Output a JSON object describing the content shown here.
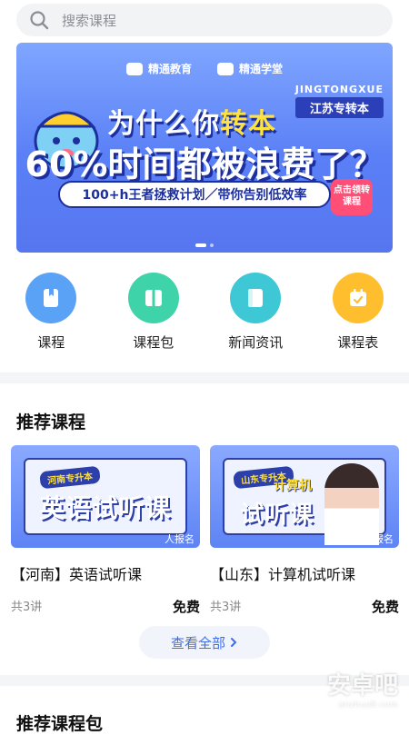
{
  "search": {
    "placeholder": "搜索课程"
  },
  "banner": {
    "logo_left": "精通教育",
    "logo_right": "精通学堂",
    "tag_en": "JINGTONGXUE",
    "tag_zh": "江苏专转本",
    "line1_pre": "为什么你",
    "line1_hl": "转本",
    "line2": "60%时间都被浪费了？",
    "line3": "100+h王者拯救计划／带你告别低效率",
    "cta": "点击领转课程"
  },
  "quick": [
    {
      "label": "课程",
      "color": "#5aa2f5",
      "icon": "book-icon"
    },
    {
      "label": "课程包",
      "color": "#3fd3a9",
      "icon": "package-icon"
    },
    {
      "label": "新闻资讯",
      "color": "#3ec8d6",
      "icon": "news-icon"
    },
    {
      "label": "课程表",
      "color": "#ffbe2e",
      "icon": "calendar-icon"
    }
  ],
  "recommend": {
    "title": "推荐课程",
    "courses": [
      {
        "thumb_tag": "河南专升本",
        "thumb_title": "英语试听课",
        "enroll": "人报名",
        "name": "【河南】英语试听课",
        "lessons": "共3讲",
        "price": "免费"
      },
      {
        "thumb_tag": "山东专升本",
        "thumb_title": "试听课",
        "thumb_sub": "计算机",
        "enroll": "1人报名",
        "name": "【山东】计算机试听课",
        "lessons": "共3讲",
        "price": "免费"
      }
    ],
    "view_all": "查看全部"
  },
  "packages": {
    "title": "推荐课程包"
  },
  "watermark": {
    "main": "安卓吧",
    "sub": "anzhuo8.com"
  }
}
